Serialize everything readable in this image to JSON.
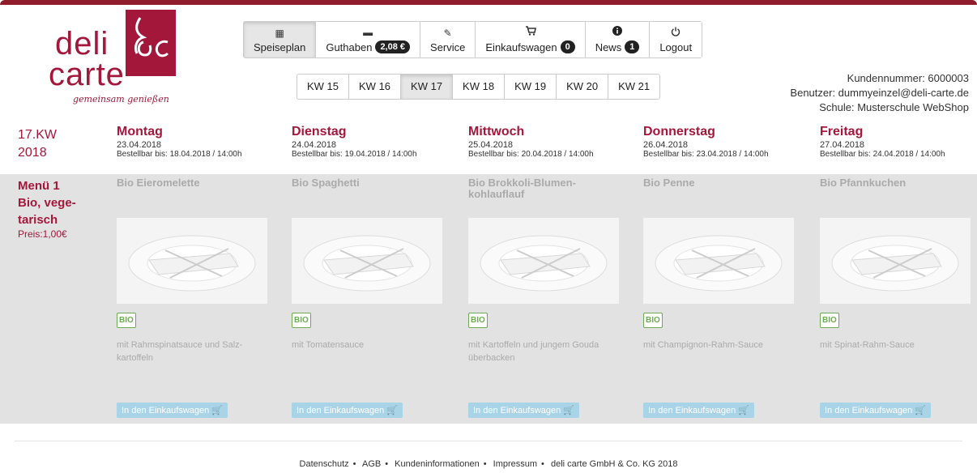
{
  "logo": {
    "word1": "deli",
    "word2": "carte",
    "tagline": "gemeinsam genießen"
  },
  "topnav": [
    {
      "label": "Speiseplan",
      "icon": "calendar-icon",
      "glyph": "▦",
      "badge": ""
    },
    {
      "label": "Guthaben",
      "icon": "card-icon",
      "glyph": "▬",
      "badge": "2,08 €"
    },
    {
      "label": "Service",
      "icon": "pencil-icon",
      "glyph": "✎",
      "badge": ""
    },
    {
      "label": "Einkaufswagen",
      "icon": "cart-icon",
      "glyph": "🛒",
      "badge": "0"
    },
    {
      "label": "News",
      "icon": "info-icon",
      "glyph": "ⓘ",
      "badge": "1"
    },
    {
      "label": "Logout",
      "icon": "power-icon",
      "glyph": "⏻",
      "badge": ""
    }
  ],
  "weeks": [
    "KW 15",
    "KW 16",
    "KW 17",
    "KW 18",
    "KW 19",
    "KW 20",
    "KW 21"
  ],
  "active_week": "KW 17",
  "customer": {
    "number": "Kundennummer: 6000003",
    "user": "Benutzer: dummyeinzel@deli-carte.de",
    "school": "Schule: Musterschule WebShop"
  },
  "kw": {
    "line1": "17.KW",
    "line2": "2018"
  },
  "days": [
    {
      "name": "Montag",
      "date": "23.04.2018",
      "order": "Bestellbar bis: 18.04.2018 / 14:00h"
    },
    {
      "name": "Dienstag",
      "date": "24.04.2018",
      "order": "Bestellbar bis: 19.04.2018 / 14:00h"
    },
    {
      "name": "Mittwoch",
      "date": "25.04.2018",
      "order": "Bestellbar bis: 20.04.2018 / 14:00h"
    },
    {
      "name": "Donnerstag",
      "date": "26.04.2018",
      "order": "Bestellbar bis: 23.04.2018 / 14:00h"
    },
    {
      "name": "Freitag",
      "date": "27.04.2018",
      "order": "Bestellbar bis: 24.04.2018 / 14:00h"
    }
  ],
  "menu": {
    "title_lines": [
      "Menü 1",
      "Bio, vege-",
      "tarisch"
    ],
    "price": "Preis:1,00€",
    "bio_label": "BIO",
    "cart_label": "In den Einkaufswagen",
    "dishes": [
      {
        "name": "Bio Eieromelette",
        "desc": "mit Rahmspinatsauce und Salz-kartoffeln"
      },
      {
        "name": "Bio Spaghetti",
        "desc": "mit Tomatensauce"
      },
      {
        "name": "Bio Brokkoli-Blumen-kohlauflauf",
        "desc": "mit Kartoffeln und jungem Gouda überbacken"
      },
      {
        "name": "Bio Penne",
        "desc": "mit Champignon-Rahm-Sauce"
      },
      {
        "name": "Bio Pfannkuchen",
        "desc": "mit Spinat-Rahm-Sauce"
      }
    ]
  },
  "footer": [
    "Datenschutz",
    "AGB",
    "Kundeninformationen",
    "Impressum",
    "deli carte GmbH & Co. KG 2018"
  ],
  "colors": {
    "brand": "#a3173a",
    "band": "#e2e2e2",
    "bio": "#6dab52",
    "cart": "#a9d3e6"
  }
}
